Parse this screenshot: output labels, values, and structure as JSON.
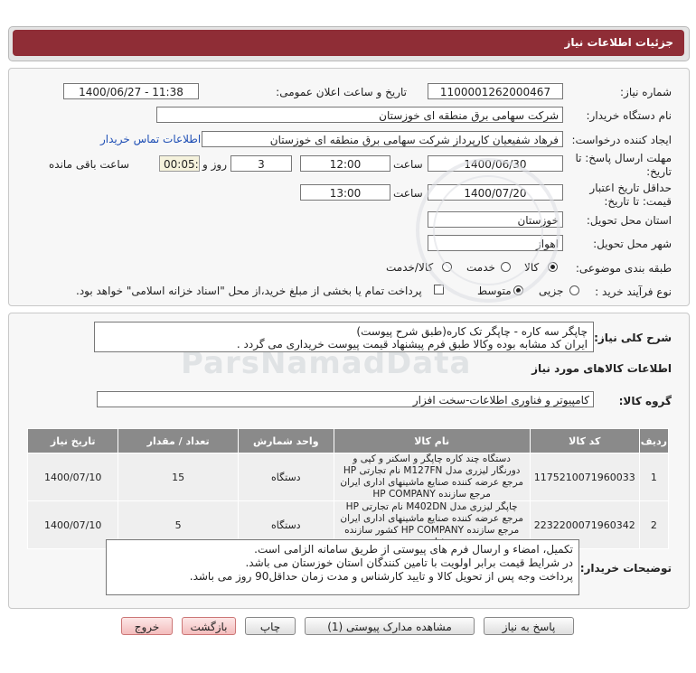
{
  "header": {
    "title": "جزئیات اطلاعات نیاز"
  },
  "form": {
    "need_number_label": "شماره نیاز:",
    "need_number": "1100001262000467",
    "announce_label": "تاریخ و ساعت اعلان عمومی:",
    "announce_value": "1400/06/27 - 11:38",
    "buyer_org_label": "نام دستگاه خریدار:",
    "buyer_org": "شرکت سهامی برق منطقه ای خوزستان",
    "creator_label": "ایجاد کننده درخواست:",
    "creator": "فرهاد شفیعیان کارپرداز شرکت سهامی برق منطقه ای خوزستان",
    "contact_link": "اطلاعات تماس خریدار",
    "deadline_label_1": "مهلت ارسال پاسخ: تا",
    "deadline_label_2": "تاریخ:",
    "deadline_date": "1400/06/30",
    "time_label": "ساعت",
    "deadline_time": "12:00",
    "days_value": "3",
    "days_label": "روز و",
    "remaining_time": "00:05:15",
    "remaining_label": "ساعت باقی مانده",
    "validity_label_1": "حداقل تاریخ اعتبار",
    "validity_label_2": "قیمت: تا تاریخ:",
    "validity_date": "1400/07/20",
    "validity_time_label": "ساعت",
    "validity_time": "13:00",
    "province_label": "استان محل تحویل:",
    "province": "خوزستان",
    "city_label": "شهر محل تحویل:",
    "city": "اهواز",
    "category_label": "طبقه بندی موضوعی:",
    "category_options": [
      "کالا",
      "خدمت",
      "کالا/خدمت"
    ],
    "process_label": "نوع فرآیند خرید :",
    "process_options": [
      "جزیی",
      "متوسط"
    ],
    "payment_note": "پرداخت تمام یا بخشی از مبلغ خرید،از محل \"اسناد خزانه اسلامی\" خواهد بود."
  },
  "description": {
    "label": "شرح کلی نیاز:",
    "line1": "چاپگر سه کاره - چاپگر تک کاره(طبق شرح پیوست)",
    "line2": "ایران کد مشابه بوده وکالا طبق فرم پیشنهاد قیمت پیوست خریداری می گردد ."
  },
  "goods": {
    "section_title": "اطلاعات کالاهای مورد نیاز",
    "group_label": "گروه کالا:",
    "group_value": "کامپیوتر و فناوری اطلاعات-سخت افزار",
    "columns": [
      "ردیف",
      "کد کالا",
      "نام کالا",
      "واحد شمارش",
      "تعداد / مقدار",
      "تاریخ نیاز"
    ],
    "rows": [
      {
        "row": "1",
        "code": "1175210071960033",
        "name": "دستگاه چند کاره چاپگر و اسکنر و کپی و دورنگار لیزری مدل M127FN نام تجارتی HP مرجع عرضه کننده صنایع ماشینهای اداری ایران مرجع سازنده HP COMPANY",
        "unit": "دستگاه",
        "qty": "15",
        "date": "1400/07/10"
      },
      {
        "row": "2",
        "code": "2232200071960342",
        "name": "چاپگر لیزری مدل M402DN نام تجارتی HP مرجع عرضه کننده صنایع ماشینهای اداری ایران مرجع سازنده HP COMPANY کشور سازنده فیلیپین",
        "unit": "دستگاه",
        "qty": "5",
        "date": "1400/07/10"
      }
    ]
  },
  "buyer_notes": {
    "label": "توضیحات خریدار:",
    "line1": "تکمیل، امضاء و ارسال فرم های پیوستی از طریق سامانه الزامی است.",
    "line2": "در شرایط قیمت برابر اولویت با تامین کنندگان استان خوزستان می باشد.",
    "line3": "پرداخت وجه پس از تحویل کالا و تایید کارشناس و مدت زمان حداقل90 روز می باشد."
  },
  "buttons": {
    "reply": "پاسخ به نیاز",
    "attachments": "مشاهده مدارک پیوستی (1)",
    "print": "چاپ",
    "back": "بازگشت",
    "exit": "خروج"
  },
  "watermark": {
    "brand": "ParsNamadData"
  }
}
